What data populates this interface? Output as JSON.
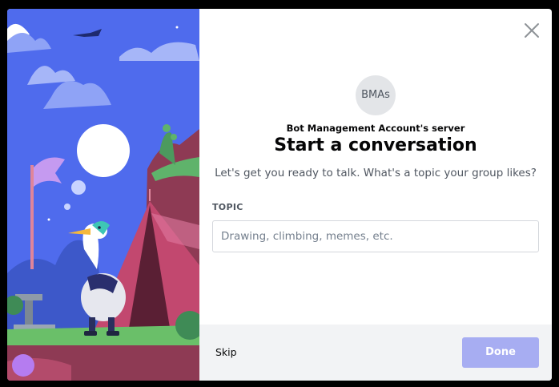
{
  "modal": {
    "server_icon_text": "BMAs",
    "server_name": "Bot Management Account's server",
    "title": "Start a conversation",
    "subtitle": "Let's get you ready to talk. What's a topic your group likes?",
    "topic_label": "TOPIC",
    "topic_value": "",
    "topic_placeholder": "Drawing, climbing, memes, etc.",
    "skip_label": "Skip",
    "done_label": "Done",
    "done_disabled": true
  },
  "icons": {
    "close": "close-icon",
    "illustration": "illustration-bird-tent"
  },
  "colors": {
    "accent": "#5865f2",
    "done_disabled": "#a7adf2",
    "sky": "#4f6bed",
    "footer": "#f2f3f5"
  }
}
